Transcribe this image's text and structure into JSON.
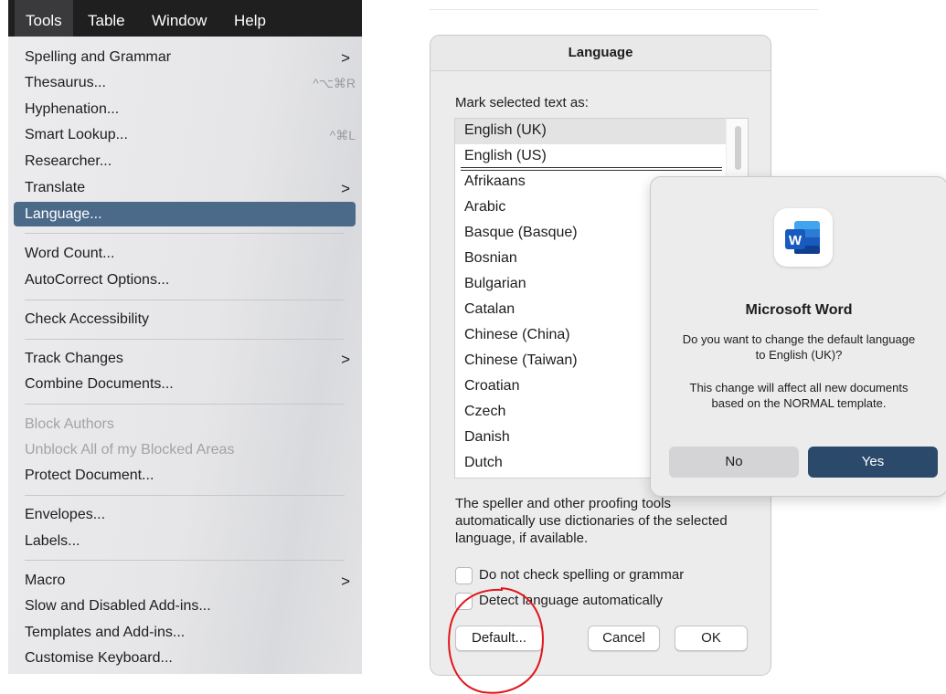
{
  "menubar": {
    "items": [
      {
        "label": "Tools"
      },
      {
        "label": "Table"
      },
      {
        "label": "Window"
      },
      {
        "label": "Help"
      }
    ]
  },
  "tools_menu": {
    "items": [
      {
        "label": "Spelling and Grammar",
        "shortcut": "",
        "submenu": true,
        "state": "normal"
      },
      {
        "label": "Thesaurus...",
        "shortcut": "^⌥⌘R",
        "submenu": false,
        "state": "normal"
      },
      {
        "label": "Hyphenation...",
        "shortcut": "",
        "submenu": false,
        "state": "normal"
      },
      {
        "label": "Smart Lookup...",
        "shortcut": "^⌘L",
        "submenu": false,
        "state": "normal"
      },
      {
        "label": "Researcher...",
        "shortcut": "",
        "submenu": false,
        "state": "normal"
      },
      {
        "label": "Translate",
        "shortcut": "",
        "submenu": true,
        "state": "normal"
      },
      {
        "label": "Language...",
        "shortcut": "",
        "submenu": false,
        "state": "highlighted"
      },
      {
        "label": "Word Count...",
        "shortcut": "",
        "submenu": false,
        "state": "normal"
      },
      {
        "label": "AutoCorrect Options...",
        "shortcut": "",
        "submenu": false,
        "state": "normal"
      },
      {
        "label": "Check Accessibility",
        "shortcut": "",
        "submenu": false,
        "state": "normal"
      },
      {
        "label": "Track Changes",
        "shortcut": "",
        "submenu": true,
        "state": "normal"
      },
      {
        "label": "Combine Documents...",
        "shortcut": "",
        "submenu": false,
        "state": "normal"
      },
      {
        "label": "Block Authors",
        "shortcut": "",
        "submenu": false,
        "state": "disabled"
      },
      {
        "label": "Unblock All of my Blocked Areas",
        "shortcut": "",
        "submenu": false,
        "state": "disabled"
      },
      {
        "label": "Protect Document...",
        "shortcut": "",
        "submenu": false,
        "state": "normal"
      },
      {
        "label": "Envelopes...",
        "shortcut": "",
        "submenu": false,
        "state": "normal"
      },
      {
        "label": "Labels...",
        "shortcut": "",
        "submenu": false,
        "state": "normal"
      },
      {
        "label": "Macro",
        "shortcut": "",
        "submenu": true,
        "state": "normal"
      },
      {
        "label": "Slow and Disabled Add-ins...",
        "shortcut": "",
        "submenu": false,
        "state": "normal"
      },
      {
        "label": "Templates and Add-ins...",
        "shortcut": "",
        "submenu": false,
        "state": "normal"
      },
      {
        "label": "Customise Keyboard...",
        "shortcut": "",
        "submenu": false,
        "state": "normal"
      }
    ],
    "submenu_glyph": ">",
    "highlight_color": "#4b6a8a"
  },
  "language_dialog": {
    "title": "Language",
    "mark_label": "Mark selected text as:",
    "selected_language": "English (UK)",
    "languages": [
      "English (UK)",
      "English (US)",
      "Afrikaans",
      "Arabic",
      "Basque (Basque)",
      "Bosnian",
      "Bulgarian",
      "Catalan",
      "Chinese (China)",
      "Chinese (Taiwan)",
      "Croatian",
      "Czech",
      "Danish",
      "Dutch"
    ],
    "speller_note": "The speller and other proofing tools automatically use dictionaries of the selected language, if available.",
    "checkbox_no_check": {
      "label": "Do not check spelling or grammar",
      "checked": false
    },
    "checkbox_detect": {
      "label": "Detect language automatically",
      "checked": false
    },
    "default_button": "Default...",
    "cancel_button": "Cancel",
    "ok_button": "OK",
    "annotation_color": "#e0161b"
  },
  "alert": {
    "icon": "microsoft-word-icon",
    "icon_letter": "W",
    "title": "Microsoft Word",
    "message": "Do you want to change the default language to English (UK)?",
    "detail": "This change will affect all new documents based on the NORMAL template.",
    "no_button": "No",
    "yes_button": "Yes",
    "yes_color": "#2b4a6b"
  }
}
